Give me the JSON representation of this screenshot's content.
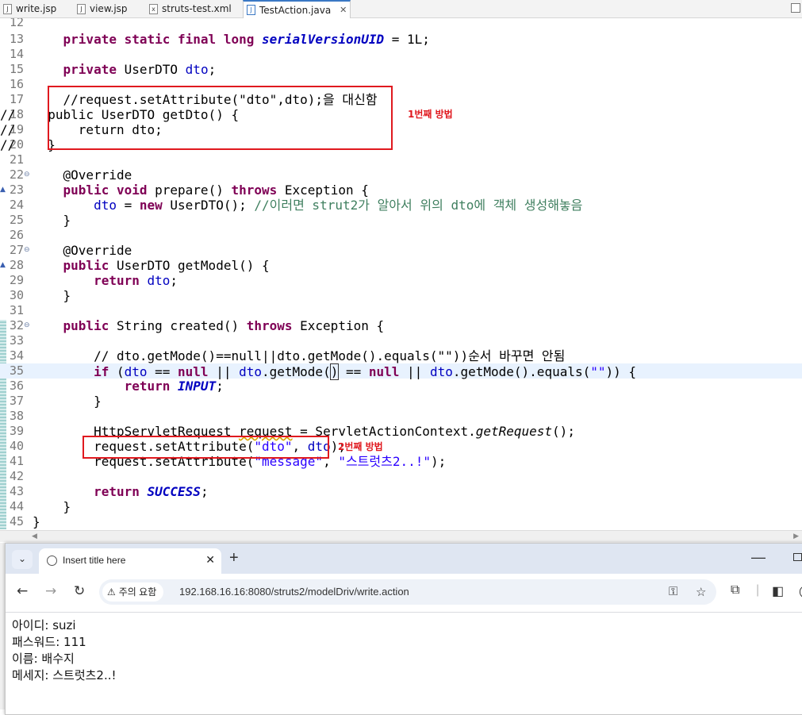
{
  "ide": {
    "tabs": [
      {
        "label": "write.jsp",
        "icon": "jsp-file-icon"
      },
      {
        "label": "view.jsp",
        "icon": "jsp-file-icon"
      },
      {
        "label": "struts-test.xml",
        "icon": "xml-file-icon"
      },
      {
        "label": "TestAction.java",
        "icon": "java-file-icon",
        "close": "✕"
      }
    ],
    "line_numbers": [
      "12",
      "13",
      "14",
      "15",
      "16",
      "17",
      "18",
      "19",
      "20",
      "21",
      "22",
      "23",
      "24",
      "25",
      "26",
      "27",
      "28",
      "29",
      "30",
      "31",
      "32",
      "33",
      "34",
      "35",
      "36",
      "37",
      "38",
      "39",
      "40",
      "41",
      "42",
      "43",
      "44",
      "45"
    ],
    "annotations": {
      "method1": "1번째 방법",
      "method2": "2번째 방법"
    }
  },
  "code": {
    "l13": {
      "kw": "private static final long",
      "field": "serialVersionUID",
      "rest": " = 1L;"
    },
    "l15": {
      "kw": "private",
      "type": " UserDTO ",
      "field": "dto",
      "rest": ";"
    },
    "l17": "//request.setAttribute(\"dto\",dto);을 대신함",
    "l18": {
      "prefix": "//",
      "text": "  public UserDTO getDto() {"
    },
    "l19": {
      "prefix": "//",
      "text": "      return dto;"
    },
    "l20": {
      "prefix": "//",
      "text": "  }"
    },
    "l22": "@Override",
    "l23": {
      "kw1": "public void",
      "mid": " prepare() ",
      "kw2": "throws",
      "rest": " Exception {"
    },
    "l24": {
      "field": "dto",
      "mid": " = ",
      "kw": "new",
      "rest": " UserDTO(); ",
      "comment": "//이러면 strut2가 알아서 위의 dto에 객체 생성해놓음"
    },
    "l25": "}",
    "l27": "@Override",
    "l28": {
      "kw": "public",
      "rest": " UserDTO getModel() {"
    },
    "l29": {
      "kw": "return",
      "field": "dto",
      "rest": ";"
    },
    "l30": "}",
    "l32": {
      "kw1": "public",
      "mid": " String created() ",
      "kw2": "throws",
      "rest": " Exception {"
    },
    "l34": "// dto.getMode()==null||dto.getMode().equals(\"\"))순서 바꾸면 안됨",
    "l35": {
      "kw_if": "if",
      "p1": " (",
      "field1": "dto",
      "p2": " == ",
      "kw_null1": "null",
      "p3": " || ",
      "field2": "dto",
      "p4": ".getMode(",
      "caret": ")",
      "p5": " == ",
      "kw_null2": "null",
      "p6": " || ",
      "field3": "dto",
      "p7": ".getMode().equals(",
      "str": "\"\"",
      "p8": ")) {"
    },
    "l36": {
      "kw": "return",
      "const": "INPUT",
      "rest": ";"
    },
    "l37": "}",
    "l39": {
      "a": "HttpServletRequest ",
      "var": "request",
      "b": " = ServletActionContext.",
      "m": "getRequest",
      "c": "();"
    },
    "l40": {
      "a": "request.setAttribute(",
      "str": "\"dto\"",
      "b": ", ",
      "field": "dto",
      "c": ");"
    },
    "l41": {
      "a": "request.setAttribute(",
      "str1": "\"message\"",
      "b": ", ",
      "str2": "\"스트럿츠2..!\"",
      "c": ");"
    },
    "l43": {
      "kw": "return",
      "const": "SUCCESS",
      "rest": ";"
    },
    "l44": "}",
    "l45": "}"
  },
  "browser": {
    "tab_title": "Insert title here",
    "tab_close": "✕",
    "new_tab": "+",
    "security_label": "주의 요함",
    "url": "192.168.16.16:8080/struts2/modelDriv/write.action",
    "content": [
      "아이디: suzi",
      "패스워드: 111",
      "이름: 배수지",
      "메세지: 스트럿츠2..!"
    ]
  },
  "colors": {
    "keyword": "#7f0055",
    "comment": "#3f7f5f",
    "string": "#2a00ff",
    "field": "#0000c0",
    "annotation_red": "#e0191f",
    "current_line": "#e8f2fe"
  }
}
